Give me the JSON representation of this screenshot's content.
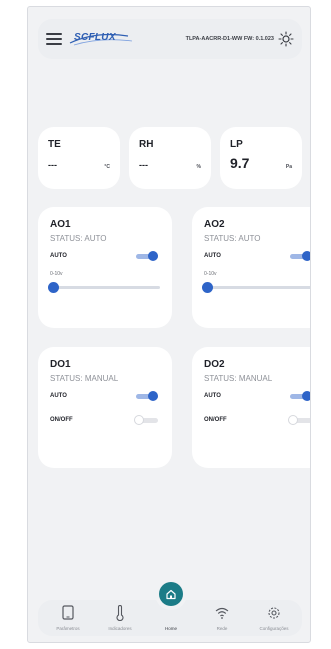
{
  "header": {
    "logo_text": "SCFLUX",
    "info": "TLPA-AACRR-D1-WW FW: 0.1.023"
  },
  "sensors": [
    {
      "title": "TE",
      "value": "---",
      "unit": "°C"
    },
    {
      "title": "RH",
      "value": "---",
      "unit": "%"
    },
    {
      "title": "LP",
      "value": "9.7",
      "unit": "Pa"
    }
  ],
  "analog": [
    {
      "name": "AO1",
      "status": "STATUS: AUTO",
      "auto_label": "AUTO",
      "auto_on": true,
      "range_label": "0-10v",
      "level": 0
    },
    {
      "name": "AO2",
      "status": "STATUS: AUTO",
      "auto_label": "AUTO",
      "auto_on": true,
      "range_label": "0-10v",
      "level": 0
    }
  ],
  "digital": [
    {
      "name": "DO1",
      "status": "STATUS: MANUAL",
      "auto_label": "AUTO",
      "auto_on": true,
      "onoff_label": "ON/OFF",
      "onoff_on": false
    },
    {
      "name": "DO2",
      "status": "STATUS: MANUAL",
      "auto_label": "AUTO",
      "auto_on": true,
      "onoff_label": "ON/OFF",
      "onoff_on": false
    }
  ],
  "nav": {
    "items": [
      {
        "label": "Parâmetros",
        "icon": "tablet-icon"
      },
      {
        "label": "Indicadores",
        "icon": "thermometer-icon"
      },
      {
        "label": "Home",
        "icon": "home-icon"
      },
      {
        "label": "Rede",
        "icon": "wifi-icon"
      },
      {
        "label": "Configurações",
        "icon": "gear-icon"
      }
    ]
  },
  "colors": {
    "accent": "#2e64c8",
    "home": "#1c7c87",
    "card": "#ffffff",
    "background": "#f1f2f4"
  }
}
